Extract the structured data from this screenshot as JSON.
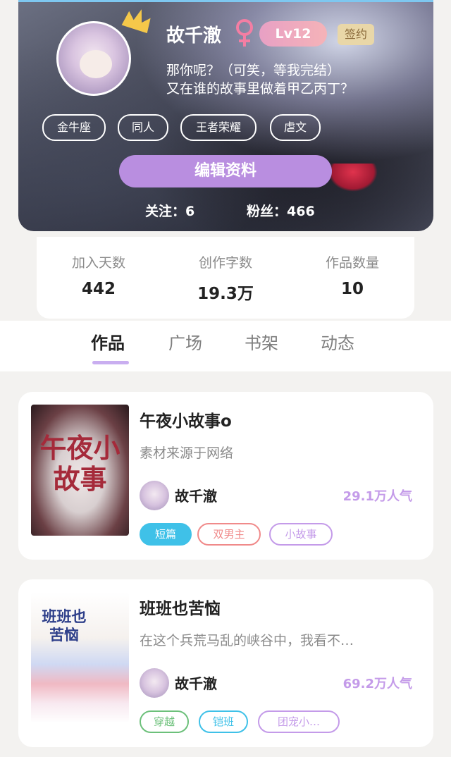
{
  "profile": {
    "username": "故千澈",
    "level": "Lv12",
    "sign_badge": "签约",
    "bio_line1": "那你呢？（可笑，等我完结）",
    "bio_line2": "又在谁的故事里做着甲乙丙丁？",
    "tags": [
      "金牛座",
      "同人",
      "王者荣耀",
      "虐文"
    ],
    "edit_button": "编辑资料",
    "following": "关注：6",
    "followers": "粉丝：466"
  },
  "stats": [
    {
      "label": "加入天数",
      "value": "442"
    },
    {
      "label": "创作字数",
      "value": "19.3万"
    },
    {
      "label": "作品数量",
      "value": "10"
    }
  ],
  "tabs": [
    "作品",
    "广场",
    "书架",
    "动态"
  ],
  "works": [
    {
      "cover_text": "午夜小故事",
      "title": "午夜小故事o",
      "desc": "素材来源于网络",
      "author": "故千澈",
      "popularity": "29.1万人气",
      "tags": [
        {
          "label": "短篇",
          "style": "filled",
          "color": "#3fc1e8"
        },
        {
          "label": "双男主",
          "style": "outline",
          "color": "#f08a8a"
        },
        {
          "label": "小故事",
          "style": "outline",
          "color": "#c49be9"
        }
      ]
    },
    {
      "cover_text": "班班也苦恼",
      "title": "班班也苦恼",
      "desc": "在这个兵荒马乱的峡谷中，我看不…",
      "author": "故千澈",
      "popularity": "69.2万人气",
      "tags": [
        {
          "label": "穿越",
          "style": "outline",
          "color": "#6cc07a"
        },
        {
          "label": "铠班",
          "style": "outline",
          "color": "#3fc1e8"
        },
        {
          "label": "团宠小…",
          "style": "outline",
          "color": "#c49be9"
        }
      ]
    }
  ],
  "colors": {
    "accent": "#b98ee0",
    "popularity": "#c49be9",
    "tab_underline": "#c9aef0"
  }
}
